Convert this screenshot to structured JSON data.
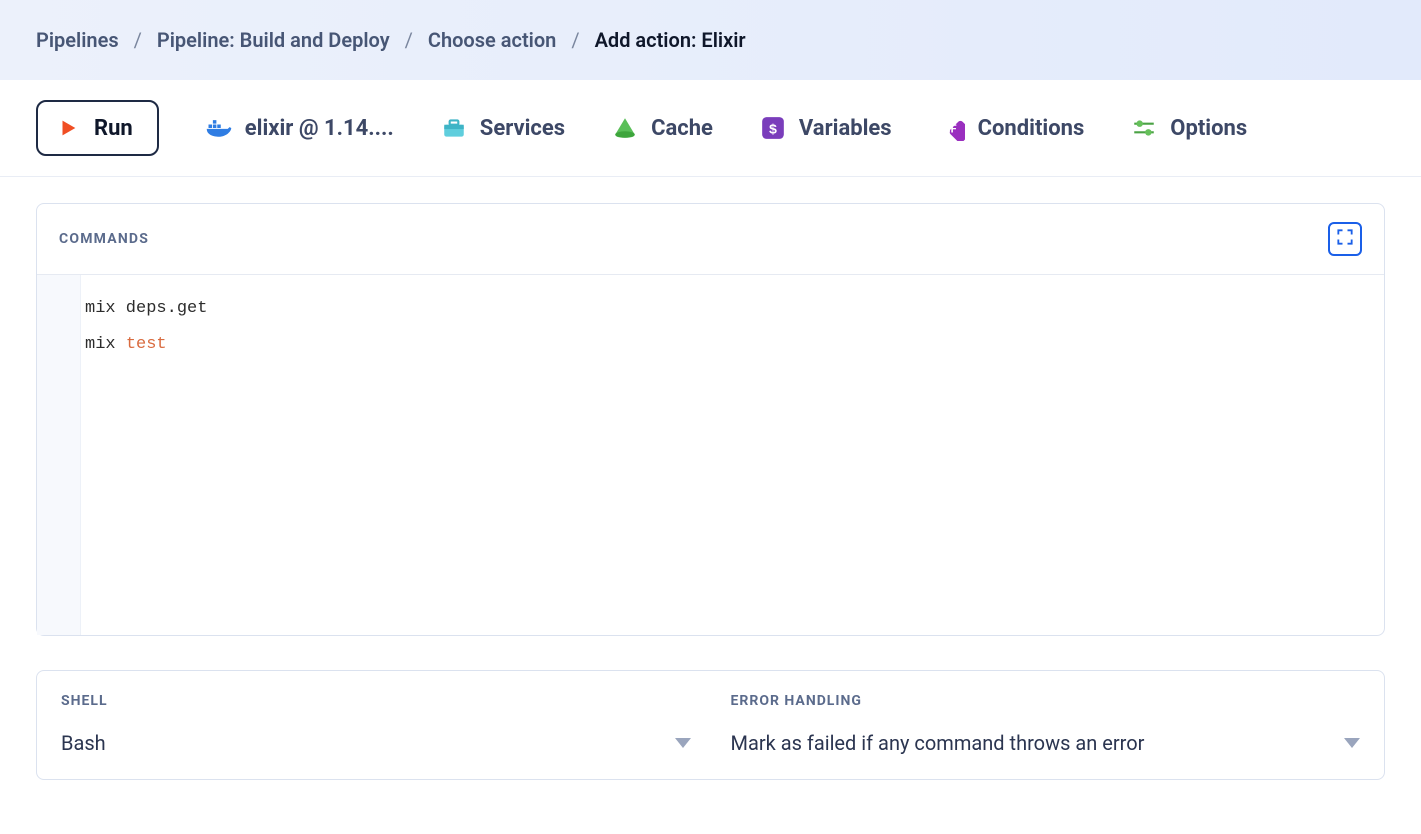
{
  "breadcrumb": {
    "items": [
      "Pipelines",
      "Pipeline: Build and Deploy",
      "Choose action"
    ],
    "current": "Add action: Elixir"
  },
  "tabs": {
    "run": {
      "label": "Run"
    },
    "image": {
      "label": "elixir @ 1.14...."
    },
    "services": {
      "label": "Services"
    },
    "cache": {
      "label": "Cache"
    },
    "variables": {
      "label": "Variables"
    },
    "conditions": {
      "label": "Conditions"
    },
    "options": {
      "label": "Options"
    }
  },
  "commands": {
    "title": "COMMANDS",
    "lines": [
      {
        "text": "mix deps.get",
        "highlight": null
      },
      {
        "text": "mix test",
        "highlight": "test"
      }
    ]
  },
  "shell": {
    "label": "SHELL",
    "value": "Bash"
  },
  "error_handling": {
    "label": "ERROR HANDLING",
    "value": "Mark as failed if any command throws an error"
  }
}
